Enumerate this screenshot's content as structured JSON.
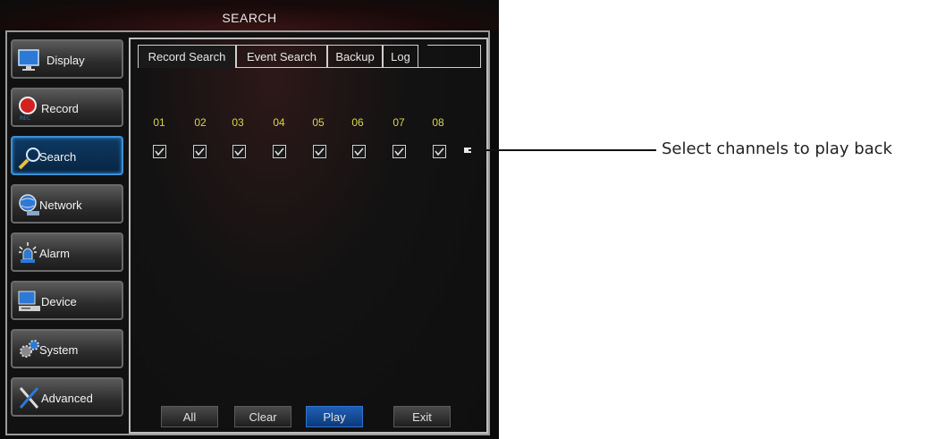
{
  "window": {
    "title": "SEARCH"
  },
  "sidebar": {
    "items": [
      {
        "label": "Display",
        "icon": "monitor-icon"
      },
      {
        "label": "Record",
        "icon": "record-icon"
      },
      {
        "label": "Search",
        "icon": "magnifier-icon",
        "active": true
      },
      {
        "label": "Network",
        "icon": "network-globe-icon"
      },
      {
        "label": "Alarm",
        "icon": "alarm-siren-icon"
      },
      {
        "label": "Device",
        "icon": "device-computer-icon"
      },
      {
        "label": "System",
        "icon": "system-gears-icon"
      },
      {
        "label": "Advanced",
        "icon": "advanced-tools-icon"
      }
    ]
  },
  "tabs": [
    {
      "label": "Record Search",
      "active": true
    },
    {
      "label": "Event Search"
    },
    {
      "label": "Backup"
    },
    {
      "label": "Log"
    }
  ],
  "channels": [
    {
      "number": "01",
      "checked": true
    },
    {
      "number": "02",
      "checked": true
    },
    {
      "number": "03",
      "checked": true
    },
    {
      "number": "04",
      "checked": true
    },
    {
      "number": "05",
      "checked": true
    },
    {
      "number": "06",
      "checked": true
    },
    {
      "number": "07",
      "checked": true
    },
    {
      "number": "08",
      "checked": true
    }
  ],
  "buttons": {
    "all": "All",
    "clear": "Clear",
    "play": "Play",
    "exit": "Exit"
  },
  "annotation": {
    "text": "Select channels to play back"
  },
  "colors": {
    "channel_number": "#d8d64a",
    "active_accent": "#3b8fd6",
    "play_button": "#1f5fb4"
  }
}
